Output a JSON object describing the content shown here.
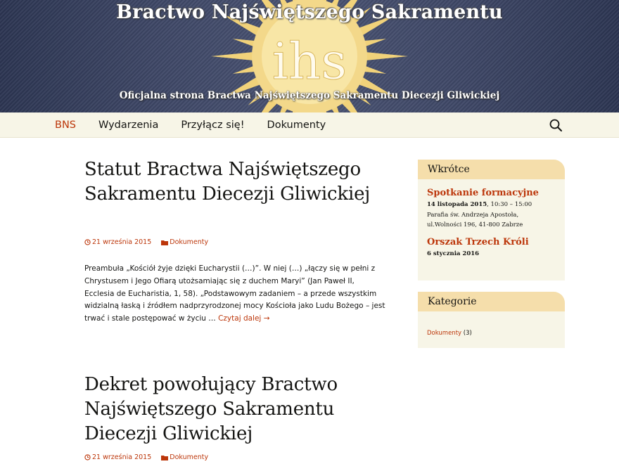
{
  "header": {
    "site_title": "Bractwo Najświętszego Sakramentu",
    "site_description": "Oficjalna strona Bractwa Najświętszego Sakramentu Diecezji Gliwickiej",
    "emblem_text": "ihs",
    "emblem_colors": {
      "rays": "#f1d27a",
      "center": "#fdf2c8"
    }
  },
  "nav": {
    "items": [
      {
        "label": "BNS",
        "active": true
      },
      {
        "label": "Wydarzenia"
      },
      {
        "label": "Przyłącz się!"
      },
      {
        "label": "Dokumenty"
      }
    ],
    "search_icon": "search-icon"
  },
  "posts": [
    {
      "title": "Statut Bractwa Najświętszego Sakramentu Diecezji Gliwickiej",
      "date": "21 września 2015",
      "category": "Dokumenty",
      "excerpt": "Preambuła „Kościół żyje dzięki Eucharystii (…)”. W niej (…) „łączy się w pełni z Chrystusem i Jego Ofiarą utożsamiając się z duchem Maryi” (Jan Paweł II, Ecclesia de Eucharistia, 1, 58). „Podstawowym zadaniem – a przede wszystkim widzialną łaską i źródłem nadprzyrodzonej mocy Kościoła jako Ludu Bożego – jest trwać i stale postępować w życiu … ",
      "read_more": "Czytaj dalej →"
    },
    {
      "title": "Dekret powołujący Bractwo Najświętszego Sakramentu Diecezji Gliwickiej",
      "date": "21 września 2015",
      "category": "Dokumenty"
    }
  ],
  "sidebar": {
    "soon": {
      "title": "Wkrótce",
      "events": [
        {
          "title": "Spotkanie formacyjne",
          "date": "14 listopada 2015",
          "time": ", 10:30 – 15:00",
          "place1": "Parafia św. Andrzeja Apostoła,",
          "place2": "ul.Wolności 196, 41-800 Zabrze"
        },
        {
          "title": "Orszak Trzech Króli",
          "date": "6 stycznia 2016"
        }
      ]
    },
    "categories": {
      "title": "Kategorie",
      "items": [
        {
          "label": "Dokumenty",
          "count": " (3)"
        }
      ]
    }
  },
  "colors": {
    "accent": "#bc360a",
    "nav_bg": "#f7f5e7",
    "widget_title_bg": "#f5deab",
    "header_bg": "#3e4766"
  }
}
